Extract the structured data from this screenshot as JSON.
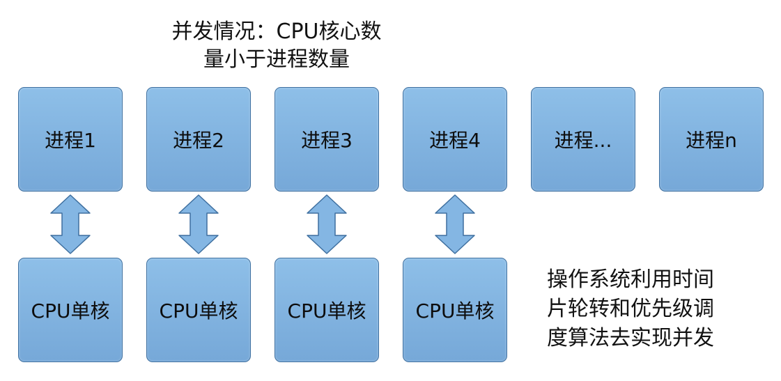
{
  "title": {
    "line1": "并发情况：CPU核心数",
    "line2": "量小于进程数量"
  },
  "processes": [
    "进程1",
    "进程2",
    "进程3",
    "进程4",
    "进程...",
    "进程n"
  ],
  "cpus": [
    "CPU单核",
    "CPU单核",
    "CPU单核",
    "CPU单核"
  ],
  "note": {
    "line1": "操作系统利用时间",
    "line2": "片轮转和优先级调",
    "line3": "度算法去实现并发"
  },
  "colors": {
    "box_fill_top": "#8ebfe8",
    "box_fill_bottom": "#76a8d8",
    "box_border": "#3e6f9f"
  },
  "icons": {
    "connector": "double-arrow-vertical-icon"
  }
}
